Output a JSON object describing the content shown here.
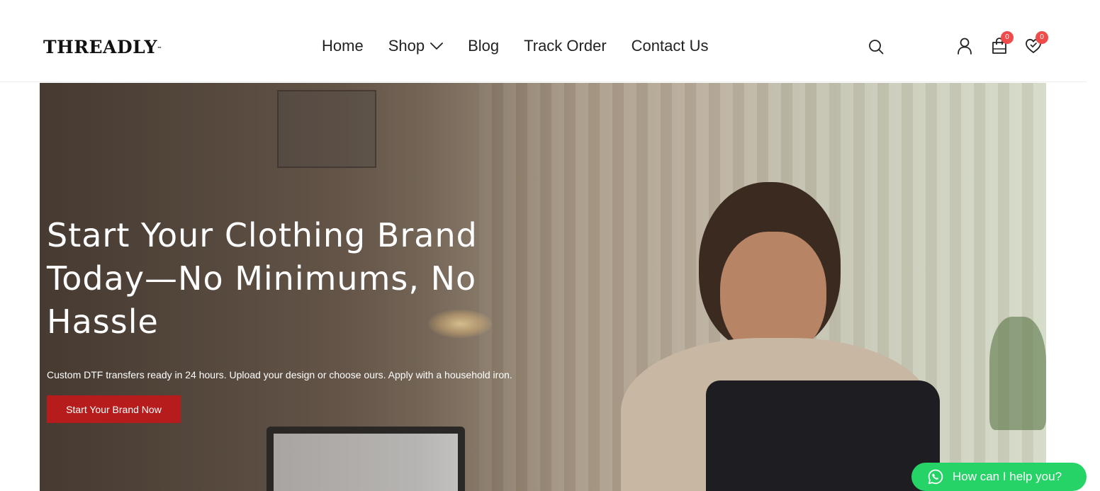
{
  "brand": {
    "name": "THREADLY",
    "trademark": "™"
  },
  "nav": {
    "items": [
      {
        "label": "Home"
      },
      {
        "label": "Shop",
        "icon": "chevron-down-icon"
      },
      {
        "label": "Blog"
      },
      {
        "label": "Track Order"
      },
      {
        "label": "Contact Us"
      }
    ]
  },
  "header_icons": {
    "search": "search-icon",
    "account": "user-icon",
    "cart": {
      "icon": "shopping-bag-icon",
      "count": "0"
    },
    "wishlist": {
      "icon": "heart-check-icon",
      "count": "0"
    },
    "badge_color": "#f04b4b"
  },
  "hero": {
    "title": "Start Your Clothing Brand Today—No Minimums, No Hassle",
    "subtitle": "Custom DTF transfers ready in 24 hours. Upload your design or choose ours. Apply with a household iron.",
    "cta_label": "Start Your Brand Now",
    "cta_color": "#b71c1c"
  },
  "chat": {
    "label": "How can I help you?",
    "icon": "whatsapp-icon",
    "color": "#25d366"
  }
}
